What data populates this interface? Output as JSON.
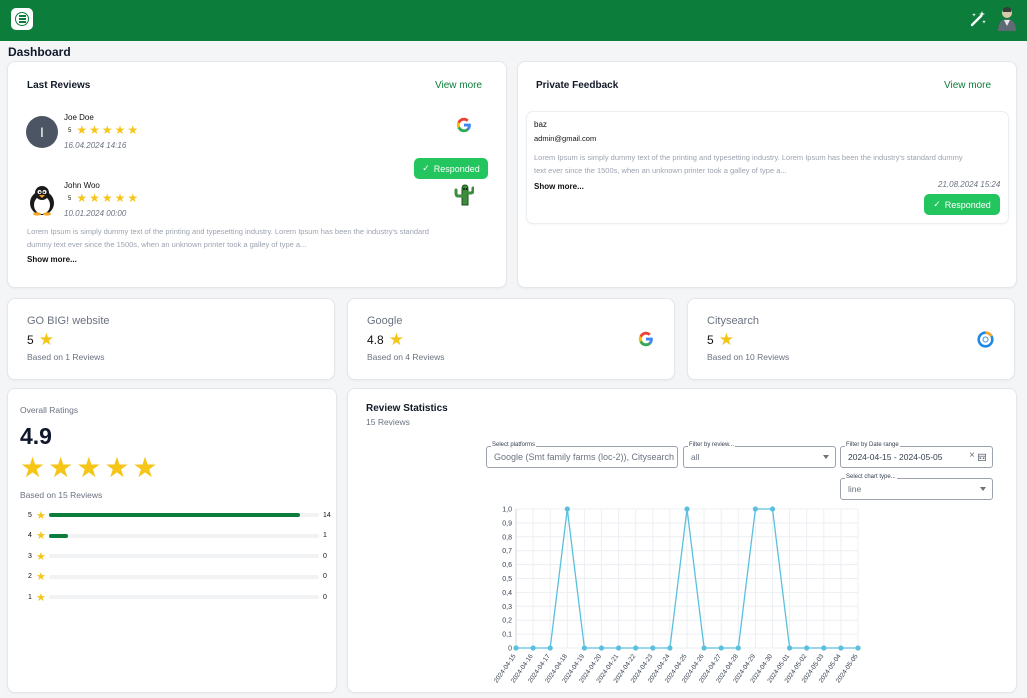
{
  "header": {
    "menu_icon": "menu-icon",
    "wand_icon": "magic-wand-icon",
    "avatar_icon": "user-avatar-icon",
    "brand_color": "#0c7d3b"
  },
  "page_title": "Dashboard",
  "last_reviews": {
    "title": "Last Reviews",
    "view_more": "View more",
    "reviews": [
      {
        "name": "Joe Doe",
        "avatar_letter": "I",
        "rating": "5",
        "date": "16.04.2024 14:16",
        "source_icon": "google-icon",
        "badge": "Responded"
      },
      {
        "name": "John Woo",
        "rating": "5",
        "date": "10.01.2024 00:00",
        "source_icon": "cactus-icon",
        "text_line1": "Lorem Ipsum is simply dummy text of the printing and typesetting industry. Lorem Ipsum has been the industry's standard",
        "text_line2": "dummy text ever since the 1500s, when an unknown printer took a galley of type a...",
        "show_more": "Show more..."
      }
    ]
  },
  "private_feedback": {
    "title": "Private Feedback",
    "view_more": "View more",
    "item": {
      "name": "baz",
      "email": "admin@gmail.com",
      "text_line1": "Lorem Ipsum is simply dummy text of the printing and typesetting industry. Lorem Ipsum has been the industry's standard dummy",
      "text_line2": "text ever since the 1500s, when an unknown printer took a galley of type a...",
      "date": "21.08.2024 15:24",
      "show_more": "Show more...",
      "badge": "Responded"
    }
  },
  "sources": [
    {
      "name": "GO BIG! website",
      "rating": "5",
      "sub": "Based on 1 Reviews",
      "icon": ""
    },
    {
      "name": "Google",
      "rating": "4.8",
      "sub": "Based on 4 Reviews",
      "icon": "google-icon"
    },
    {
      "name": "Citysearch",
      "rating": "5",
      "sub": "Based on 10 Reviews",
      "icon": "citysearch-icon"
    }
  ],
  "overall": {
    "label": "Overall Ratings",
    "value": "4.9",
    "sub": "Based on 15 Reviews",
    "distribution": [
      {
        "stars": "5",
        "count": "14",
        "fraction": 0.93
      },
      {
        "stars": "4",
        "count": "1",
        "fraction": 0.07
      },
      {
        "stars": "3",
        "count": "0",
        "fraction": 0
      },
      {
        "stars": "2",
        "count": "0",
        "fraction": 0
      },
      {
        "stars": "1",
        "count": "0",
        "fraction": 0
      }
    ]
  },
  "statistics": {
    "title": "Review Statistics",
    "sub": "15 Reviews",
    "filters": {
      "platforms_label": "Select platforms",
      "platforms_value": "Google (Smt family farms (loc-2)), Citysearch",
      "review_label": "Filter by review...",
      "review_value": "all",
      "date_label": "Filter by Date range",
      "date_value": "2024-04-15 - 2024-05-05",
      "chart_type_label": "Select chart type...",
      "chart_type_value": "line"
    }
  },
  "chart_data": {
    "type": "line",
    "x": [
      "2024-04-15",
      "2024-04-16",
      "2024-04-17",
      "2024-04-18",
      "2024-04-19",
      "2024-04-20",
      "2024-04-21",
      "2024-04-22",
      "2024-04-23",
      "2024-04-24",
      "2024-04-25",
      "2024-04-26",
      "2024-04-27",
      "2024-04-28",
      "2024-04-29",
      "2024-04-30",
      "2024-05-01",
      "2024-05-02",
      "2024-05-03",
      "2024-05-04",
      "2024-05-05"
    ],
    "series": [
      {
        "values": [
          0,
          0,
          0,
          1,
          0,
          0,
          0,
          0,
          0,
          0,
          1,
          0,
          0,
          0,
          1,
          1,
          0,
          0,
          0,
          0,
          0
        ]
      }
    ],
    "yticks": [
      "0",
      "0,1",
      "0,2",
      "0,3",
      "0,4",
      "0,5",
      "0,6",
      "0,7",
      "0,8",
      "0,9",
      "1,0"
    ],
    "ylim": [
      0,
      1
    ],
    "grid": true,
    "color": "#5bc0de"
  }
}
